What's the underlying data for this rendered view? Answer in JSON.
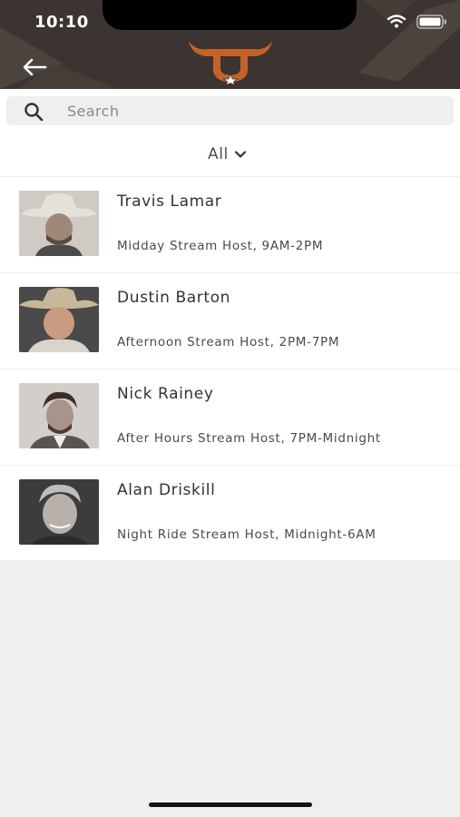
{
  "status_bar": {
    "time": "10:10",
    "wifi_icon": "wifi-icon",
    "battery_icon": "battery-icon"
  },
  "header": {
    "back_icon": "arrow-left-icon",
    "logo": "longhorn-star-logo"
  },
  "search": {
    "placeholder": "Search",
    "value": "",
    "icon": "search-icon"
  },
  "filter": {
    "label": "All",
    "icon": "chevron-down-icon"
  },
  "hosts": [
    {
      "name": "Travis Lamar",
      "show": "Midday Stream Host, 9AM-2PM"
    },
    {
      "name": "Dustin Barton",
      "show": "Afternoon Stream Host, 2PM-7PM"
    },
    {
      "name": "Nick Rainey",
      "show": "After Hours Stream Host, 7PM-Midnight"
    },
    {
      "name": "Alan Driskill",
      "show": "Night Ride Stream Host, Midnight-6AM"
    }
  ],
  "colors": {
    "header_bg": "#3b3430",
    "logo_orange": "#c4622a",
    "list_bg": "#ffffff",
    "page_bg": "#efefef"
  }
}
